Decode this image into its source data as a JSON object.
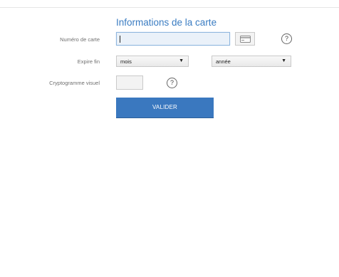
{
  "form": {
    "title": "Informations de la carte",
    "card_number": {
      "label": "Numéro de carte",
      "value": ""
    },
    "expiry": {
      "label": "Expire fin",
      "month_value": "mois",
      "year_value": "année"
    },
    "cvv": {
      "label": "Cryptogramme visuel",
      "value": ""
    },
    "help_glyph": "?",
    "submit_label": "VALIDER"
  },
  "icons": {
    "card": "credit-card-icon",
    "help": "help-icon",
    "dropdown": "chevron-down-icon"
  },
  "colors": {
    "accent": "#3a7cc2",
    "button": "#3a78bf",
    "input_focus": "#eaf1f9"
  }
}
